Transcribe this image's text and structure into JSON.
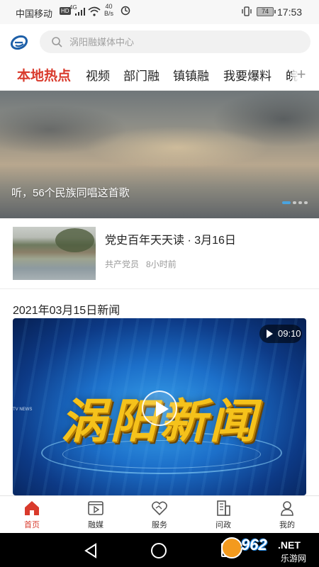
{
  "status_bar": {
    "carrier": "中国移动",
    "hd": "HD",
    "network": "4G",
    "speed_value": "40",
    "speed_unit": "B/s",
    "battery": "74",
    "time": "17:53"
  },
  "header": {
    "search_placeholder": "涡阳融媒体中心"
  },
  "tabs": [
    {
      "label": "本地热点",
      "active": true
    },
    {
      "label": "视频"
    },
    {
      "label": "部门融"
    },
    {
      "label": "镇镇融"
    },
    {
      "label": "我要爆料"
    },
    {
      "label": "皖"
    }
  ],
  "tabs_add": "+",
  "banner": {
    "caption": "听，56个民族同唱这首歌",
    "slides": 4,
    "active_slide": 1
  },
  "news_item": {
    "title": "党史百年天天读 · 3月16日",
    "source": "共产党员",
    "time": "8小时前"
  },
  "section": {
    "title": "2021年03月15日新闻"
  },
  "video": {
    "duration": "09:10",
    "cover_text": "涡阳新闻",
    "cover_small_text": "TV NEWS"
  },
  "bottom_nav": [
    {
      "label": "首页",
      "icon": "home-icon",
      "active": true
    },
    {
      "label": "融媒",
      "icon": "media-icon"
    },
    {
      "label": "服务",
      "icon": "service-icon"
    },
    {
      "label": "问政",
      "icon": "inquiry-icon"
    },
    {
      "label": "我的",
      "icon": "user-icon"
    }
  ],
  "watermark": {
    "num": "962",
    "net": ".NET",
    "cn": "乐游网"
  },
  "colors": {
    "accent": "#d93a2c",
    "dot_active": "#4aa3df"
  }
}
